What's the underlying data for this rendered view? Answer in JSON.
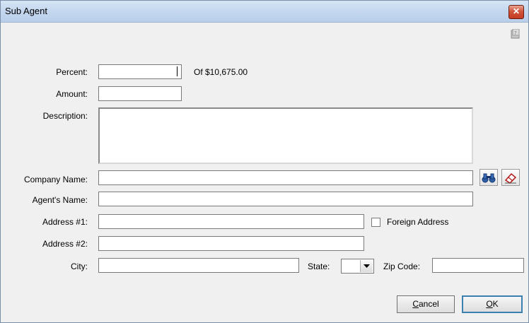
{
  "window": {
    "title": "Sub Agent",
    "close_label": "✕"
  },
  "form": {
    "percent_label": "Percent:",
    "percent_value": "",
    "of_total": "Of $10,675.00",
    "amount_label": "Amount:",
    "amount_value": "",
    "description_label": "Description:",
    "description_value": "",
    "company_label": "Company Name:",
    "company_value": "",
    "agent_label": "Agent's Name:",
    "agent_value": "",
    "address1_label": "Address #1:",
    "address1_value": "",
    "foreign_address_label": "Foreign Address",
    "foreign_address_checked": false,
    "address2_label": "Address #2:",
    "address2_value": "",
    "city_label": "City:",
    "city_value": "",
    "state_label": "State:",
    "state_value": "",
    "zip_label": "Zip Code:",
    "zip_value": ""
  },
  "icons": {
    "search": "binoculars-icon",
    "clear": "eraser-icon",
    "help": "help-icon"
  },
  "buttons": {
    "cancel_mnemonic": "C",
    "cancel_rest": "ancel",
    "ok_mnemonic": "O",
    "ok_rest": "K"
  }
}
